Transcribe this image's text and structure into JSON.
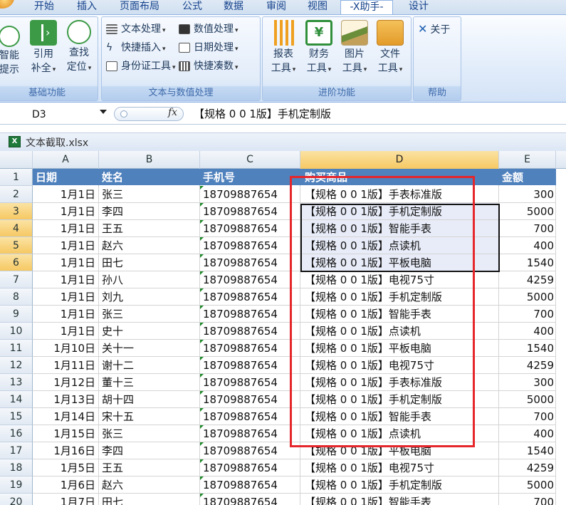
{
  "tabs": [
    "开始",
    "插入",
    "页面布局",
    "公式",
    "数据",
    "审阅",
    "视图",
    "-X助手-",
    "设计"
  ],
  "active_tab": "-X助手-",
  "ribbon": {
    "groups": {
      "basic": {
        "label": "基础功能",
        "buttons": {
          "smart": {
            "line1": "智能",
            "line2": "提示"
          },
          "ref": {
            "line1": "引用",
            "line2": "补全"
          },
          "find": {
            "line1": "查找",
            "line2": "定位"
          }
        }
      },
      "textnum": {
        "label": "文本与数值处理",
        "buttons": {
          "text_proc": "文本处理",
          "quick_insert": "快捷插入",
          "id_tool": "身份证工具",
          "num_proc": "数值处理",
          "date_proc": "日期处理",
          "quick_sum": "快捷凑数"
        }
      },
      "advanced": {
        "label": "进阶功能",
        "buttons": {
          "report": {
            "line1": "报表",
            "line2": "工具"
          },
          "finance": {
            "line1": "财务",
            "line2": "工具"
          },
          "image": {
            "line1": "图片",
            "line2": "工具"
          },
          "file": {
            "line1": "文件",
            "line2": "工具"
          }
        }
      },
      "help": {
        "label": "帮助",
        "buttons": {
          "about": "关于"
        }
      }
    }
  },
  "formula_bar": {
    "name_box": "D3",
    "fx": "fx",
    "content": "【规格 0 0 1版】手机定制版"
  },
  "workbook": {
    "title": "文本截取.xlsx"
  },
  "columns": [
    "A",
    "B",
    "C",
    "D",
    "E"
  ],
  "selected_column": "D",
  "header_row": {
    "num": "1",
    "date": "日期",
    "name": "姓名",
    "phone": "手机号",
    "product": "购买商品",
    "amount": "金额"
  },
  "rows": [
    {
      "num": "2",
      "date": "1月1日",
      "name": "张三",
      "phone": "18709887654",
      "product": "【规格 0 0 1版】手表标准版",
      "amount": "300"
    },
    {
      "num": "3",
      "date": "1月1日",
      "name": "李四",
      "phone": "18709887654",
      "product": "【规格 0 0 1版】手机定制版",
      "amount": "5000"
    },
    {
      "num": "4",
      "date": "1月1日",
      "name": "王五",
      "phone": "18709887654",
      "product": "【规格 0 0 1版】智能手表",
      "amount": "700"
    },
    {
      "num": "5",
      "date": "1月1日",
      "name": "赵六",
      "phone": "18709887654",
      "product": "【规格 0 0 1版】点读机",
      "amount": "400"
    },
    {
      "num": "6",
      "date": "1月1日",
      "name": "田七",
      "phone": "18709887654",
      "product": "【规格 0 0 1版】平板电脑",
      "amount": "1540"
    },
    {
      "num": "7",
      "date": "1月1日",
      "name": "孙八",
      "phone": "18709887654",
      "product": "【规格 0 0 1版】电视75寸",
      "amount": "4259"
    },
    {
      "num": "8",
      "date": "1月1日",
      "name": "刘九",
      "phone": "18709887654",
      "product": "【规格 0 0 1版】手机定制版",
      "amount": "5000"
    },
    {
      "num": "9",
      "date": "1月1日",
      "name": "张三",
      "phone": "18709887654",
      "product": "【规格 0 0 1版】智能手表",
      "amount": "700"
    },
    {
      "num": "10",
      "date": "1月1日",
      "name": "史十",
      "phone": "18709887654",
      "product": "【规格 0 0 1版】点读机",
      "amount": "400"
    },
    {
      "num": "11",
      "date": "1月10日",
      "name": "关十一",
      "phone": "18709887654",
      "product": "【规格 0 0 1版】平板电脑",
      "amount": "1540"
    },
    {
      "num": "12",
      "date": "1月11日",
      "name": "谢十二",
      "phone": "18709887654",
      "product": "【规格 0 0 1版】电视75寸",
      "amount": "4259"
    },
    {
      "num": "13",
      "date": "1月12日",
      "name": "董十三",
      "phone": "18709887654",
      "product": "【规格 0 0 1版】手表标准版",
      "amount": "300"
    },
    {
      "num": "14",
      "date": "1月13日",
      "name": "胡十四",
      "phone": "18709887654",
      "product": "【规格 0 0 1版】手机定制版",
      "amount": "5000"
    },
    {
      "num": "15",
      "date": "1月14日",
      "name": "宋十五",
      "phone": "18709887654",
      "product": "【规格 0 0 1版】智能手表",
      "amount": "700"
    },
    {
      "num": "16",
      "date": "1月15日",
      "name": "张三",
      "phone": "18709887654",
      "product": "【规格 0 0 1版】点读机",
      "amount": "400"
    },
    {
      "num": "17",
      "date": "1月16日",
      "name": "李四",
      "phone": "18709887654",
      "product": "【规格 0 0 1版】平板电脑",
      "amount": "1540"
    },
    {
      "num": "18",
      "date": "1月5日",
      "name": "王五",
      "phone": "18709887654",
      "product": "【规格 0 0 1版】电视75寸",
      "amount": "4259"
    },
    {
      "num": "19",
      "date": "1月6日",
      "name": "赵六",
      "phone": "18709887654",
      "product": "【规格 0 0 1版】手机定制版",
      "amount": "5000"
    },
    {
      "num": "20",
      "date": "1月7日",
      "name": "田七",
      "phone": "18709887654",
      "product": "【规格 0 0 1版】智能手表",
      "amount": "700"
    }
  ],
  "selected_rows": [
    "3",
    "4",
    "5",
    "6"
  ],
  "colors": {
    "accent_red": "#e5262b",
    "header_blue": "#4f81bd",
    "selection_orange": "#f6c863"
  }
}
